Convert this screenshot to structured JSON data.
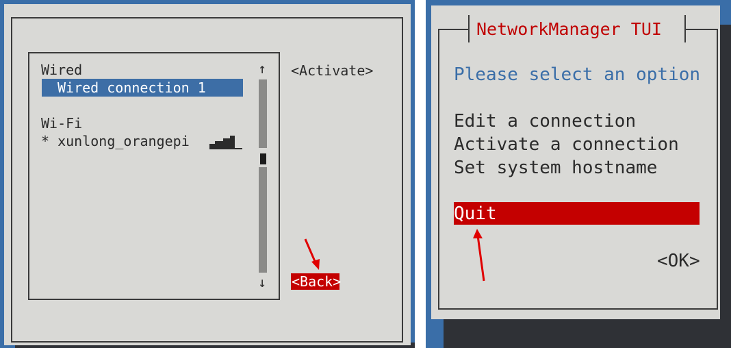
{
  "left": {
    "list": {
      "groups": [
        {
          "header": "Wired",
          "items": [
            {
              "label": "Wired connection 1",
              "selected": true
            }
          ]
        },
        {
          "header": "Wi-Fi",
          "items": [
            {
              "label": "* xunlong_orangepi",
              "signal_icon": "wifi-signal-icon"
            }
          ]
        }
      ]
    },
    "scrollbar": {
      "up": "↑",
      "down": "↓"
    },
    "buttons": {
      "activate": "<Activate>",
      "back": "<Back>"
    }
  },
  "right": {
    "title": "NetworkManager TUI",
    "prompt": "Please select an option",
    "menu": [
      "Edit a connection",
      "Activate a connection",
      "Set system hostname",
      "Quit"
    ],
    "selected_index": 3,
    "ok_button": "<OK>"
  },
  "colors": {
    "desktop_blue": "#3a6ea8",
    "dialog_grey": "#d9d9d6",
    "selection_blue": "#3d6ea6",
    "selection_red": "#c40000",
    "title_red": "#c00000",
    "prompt_blue": "#3a6ea8",
    "annotation_arrow": "#e00000"
  }
}
